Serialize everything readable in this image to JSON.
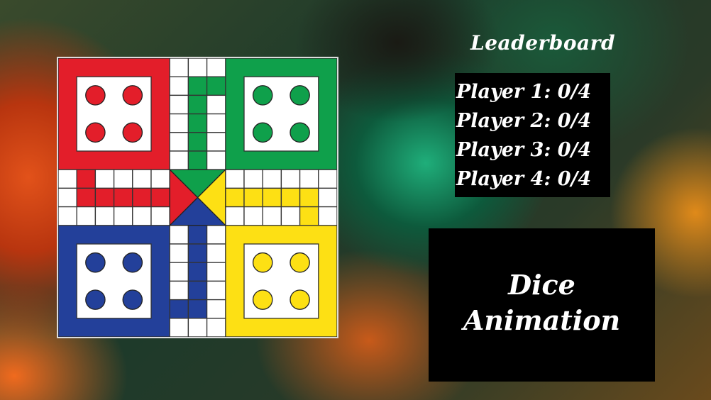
{
  "board": {
    "colors": {
      "red": "#e31e2a",
      "green": "#0fa04b",
      "yellow": "#fde014",
      "blue": "#23409a"
    },
    "tokens_per_player": 4
  },
  "leaderboard": {
    "title": "Leaderboard",
    "players": [
      {
        "label": "Player 1: 0/4"
      },
      {
        "label": "Player 2: 0/4"
      },
      {
        "label": "Player 3: 0/4"
      },
      {
        "label": "Player 4: 0/4"
      }
    ]
  },
  "dice": {
    "line1": "Dice",
    "line2": "Animation"
  }
}
